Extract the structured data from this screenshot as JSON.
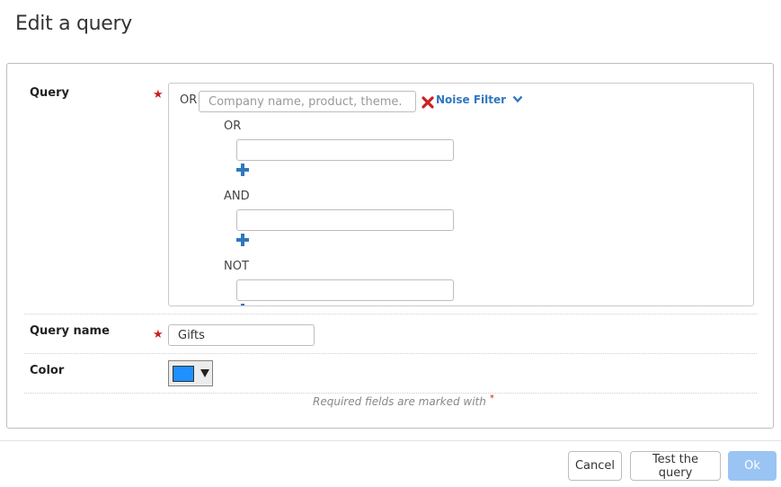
{
  "dialog": {
    "title": "Edit a query"
  },
  "form": {
    "query": {
      "label": "Query",
      "top_operator": "OR",
      "top_placeholder": "Company name, product, theme.",
      "noise_filter_label": "Noise Filter",
      "groups": [
        {
          "operator": "OR",
          "value": ""
        },
        {
          "operator": "AND",
          "value": ""
        },
        {
          "operator": "NOT",
          "value": ""
        }
      ]
    },
    "query_name": {
      "label": "Query name",
      "value": "Gifts"
    },
    "color": {
      "label": "Color",
      "value": "#1e90ff"
    },
    "required_note": "Required fields are marked with",
    "required_marker": "*"
  },
  "footer": {
    "cancel_label": "Cancel",
    "test_label": "Test the query",
    "ok_label": "Ok"
  },
  "icons": {
    "required": "star",
    "remove": "close-x",
    "add": "plus",
    "dropdown": "chevron-down"
  },
  "colors": {
    "accent": "#2f77c0",
    "required": "#cc1f1f",
    "ok_disabled": "#9ac4f3",
    "swatch": "#1e90ff"
  }
}
